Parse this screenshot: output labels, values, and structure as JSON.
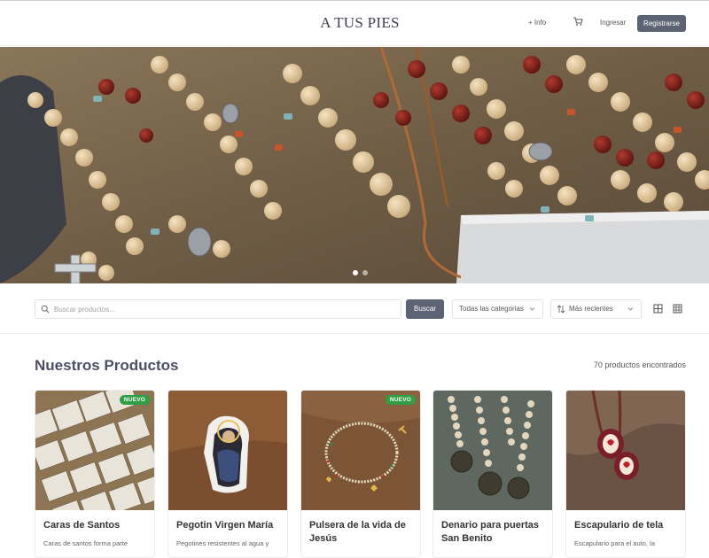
{
  "header": {
    "brand": "A TUS PIES",
    "info_label": "+ Info",
    "login_label": "Ingresar",
    "register_label": "Registrarse"
  },
  "hero": {
    "slides_count": 2,
    "active_slide": 1
  },
  "filters": {
    "search_placeholder": "Buscar productos...",
    "search_button": "Buscar",
    "category_selected": "Todas las categorias",
    "sort_selected": "Más recientes"
  },
  "products": {
    "title": "Nuestros Productos",
    "count_text": "70 productos encontrados",
    "badge_label": "NUEVO",
    "items": [
      {
        "title": "Caras de Santos",
        "desc": "Caras de santos forma parte",
        "badge": "NUEVO"
      },
      {
        "title": "Pegotin Virgen María",
        "desc": "Pegotines resistentes al agua y",
        "badge": ""
      },
      {
        "title": "Pulsera de la vida de Jesús",
        "desc": "",
        "badge": "NUEVO"
      },
      {
        "title": "Denario para puertas San Benito",
        "desc": "",
        "badge": ""
      },
      {
        "title": "Escapulario de tela",
        "desc": "Escapulario para el auto, la",
        "badge": ""
      }
    ]
  },
  "colors": {
    "primary_button": "#5c6372",
    "badge_green": "#2f9e44",
    "heading": "#4c4f63"
  }
}
